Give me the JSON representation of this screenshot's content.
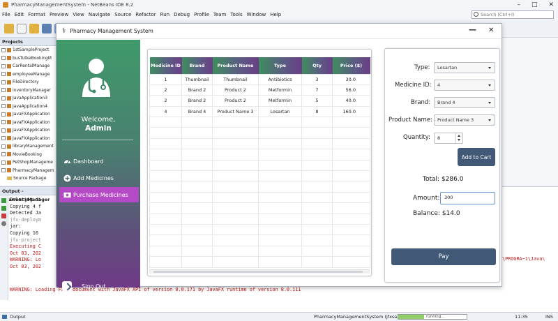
{
  "ide": {
    "title": "PharmacyManagementSystem - NetBeans IDE 8.2",
    "menu": [
      "File",
      "Edit",
      "Format",
      "Preview",
      "View",
      "Navigate",
      "Source",
      "Refactor",
      "Run",
      "Debug",
      "Profile",
      "Team",
      "Tools",
      "Window",
      "Help"
    ],
    "search_placeholder": "Search (Ctrl+I)",
    "projects_title": "Projects",
    "projects": [
      "1stSampleProject",
      "busTutkeBookingM",
      "CarRentalManage",
      "employeeManage",
      "FileDirectory",
      "inventoryManager",
      "JavaApplication3",
      "JavaApplication4",
      "JavaFXApplication",
      "JavaFXApplication",
      "JavaFXApplication",
      "JavaFXApplication",
      "libraryManagement",
      "MovieBooking",
      "PetShopManageme",
      "PharmacyManagem"
    ],
    "projects_sub": [
      "Source Package"
    ],
    "output_title": "Output - PharmacyManager",
    "output_lines": [
      {
        "text": "Deleting di",
        "cls": ""
      },
      {
        "text": "Copying 4 f",
        "cls": ""
      },
      {
        "text": "Detected Ja",
        "cls": ""
      },
      {
        "text": "jfx-deploym",
        "cls": "gray"
      },
      {
        "text": "jar:",
        "cls": ""
      },
      {
        "text": "Copying 16",
        "cls": ""
      },
      {
        "text": "jfx-project",
        "cls": "gray"
      },
      {
        "text": "Executing C",
        "cls": "warn"
      },
      {
        "text": "Oct 03, 202",
        "cls": "warn"
      },
      {
        "text": "WARNING: Lo",
        "cls": "warn"
      },
      {
        "text": "Oct 03, 202",
        "cls": "warn"
      }
    ],
    "output_right": "\\PROGRA~1\\Java\\",
    "output_last": "WARNING: Loading FXML document with JavaFX API of version 8.0.171 by JavaFX runtime of version 8.0.111",
    "status_output": "Output",
    "status_project": "PharmacyManagementSystem (jfxsa-run)",
    "status_running": "running...",
    "status_progress": 0.38,
    "status_pos": "11:35",
    "status_ins": "INS"
  },
  "app": {
    "title": "Pharmacy Management System",
    "min_label": "—",
    "close_label": "✕",
    "welcome": "Welcome,",
    "admin": "Admin",
    "nav": {
      "dashboard": "Dashboard",
      "add": "Add Medicines",
      "purchase": "Purchase Medicines"
    },
    "signout": "Sign Out",
    "table": {
      "headers": [
        "Medicine ID",
        "Brand",
        "Product Name",
        "Type",
        "Qty",
        "Price ($)"
      ],
      "rows": [
        [
          "1",
          "Thumbnail",
          "Thumbnail",
          "Antibiotics",
          "3",
          "30.0"
        ],
        [
          "2",
          "Brand 2",
          "Product 2",
          "Metformin",
          "7",
          "56.0"
        ],
        [
          "2",
          "Brand 2",
          "Product 2",
          "Metformin",
          "5",
          "40.0"
        ],
        [
          "4",
          "Brand 4",
          "Product Name 3",
          "Losartan",
          "8",
          "160.0"
        ]
      ]
    },
    "form": {
      "type_label": "Type:",
      "type_value": "Losartan",
      "id_label": "Medicine ID:",
      "id_value": "4",
      "brand_label": "Brand:",
      "brand_value": "Brand 4",
      "product_label": "Product Name:",
      "product_value": "Product Name 3",
      "qty_label": "Quantity:",
      "qty_value": "8",
      "add_cart": "Add to Cart",
      "total_label": "Total:",
      "total_value": "$286.0",
      "amount_label": "Amount:",
      "amount_value": "300",
      "balance_label": "Balance:",
      "balance_value": "$14.0",
      "pay": "Pay"
    }
  }
}
